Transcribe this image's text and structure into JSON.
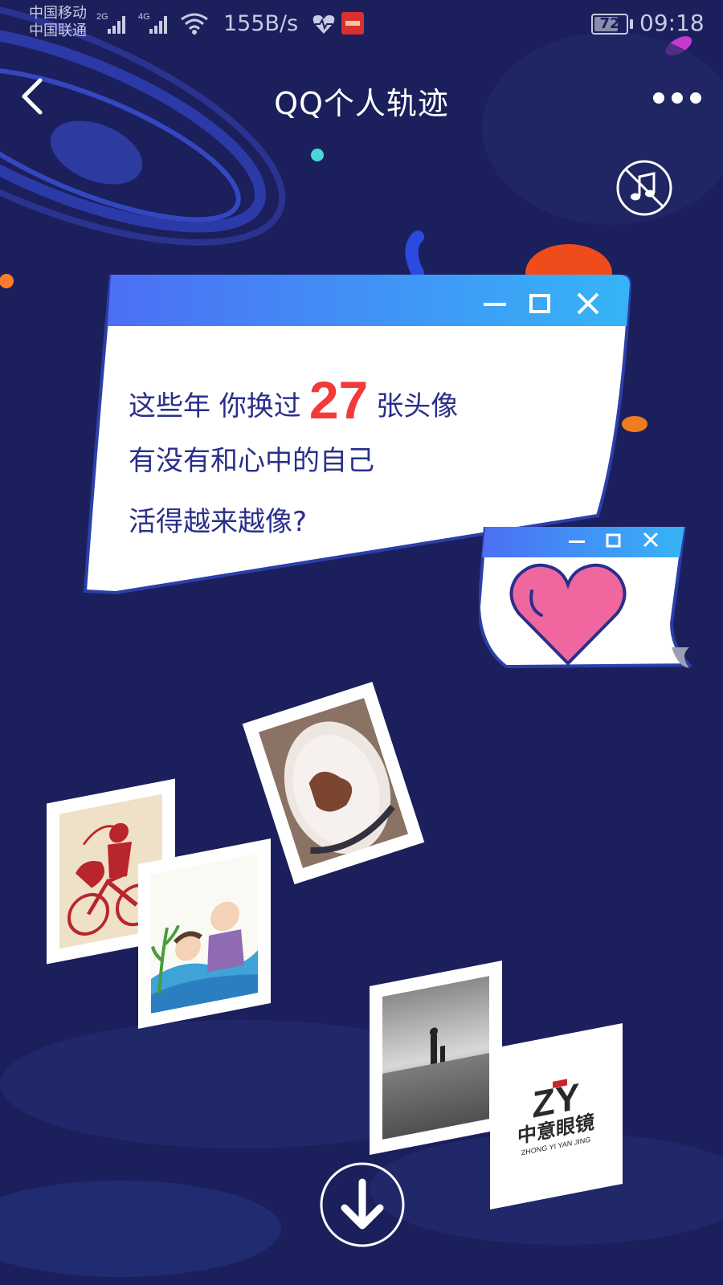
{
  "status_bar": {
    "carrier_1": "中国移动",
    "carrier_2": "中国联通",
    "sim1_tag": "2G",
    "sim2_tag": "4G",
    "net_speed": "155B/s",
    "battery": "72",
    "time": "09:18"
  },
  "nav": {
    "title": "QQ个人轨迹"
  },
  "card": {
    "line1_prefix": "这些年 你换过",
    "avatar_count": "27",
    "line1_suffix": "张头像",
    "line2": "有没有和心中的自己",
    "line3": "活得越来越像?"
  },
  "photo_texts": {
    "logo_mark": "ZY",
    "logo_cn": "中意眼镜",
    "logo_en": "ZHONG YI YAN JING"
  },
  "colors": {
    "background": "#1b1f5c",
    "window_header": "#3aa6f5",
    "window_text": "#2a2f8a",
    "highlight": "#f23a3a",
    "heart": "#f0679f"
  },
  "icons": [
    "back-chevron-icon",
    "more-dots-icon",
    "music-off-icon",
    "minimize-icon",
    "maximize-icon",
    "close-icon",
    "heart-icon",
    "arrow-down-icon"
  ]
}
